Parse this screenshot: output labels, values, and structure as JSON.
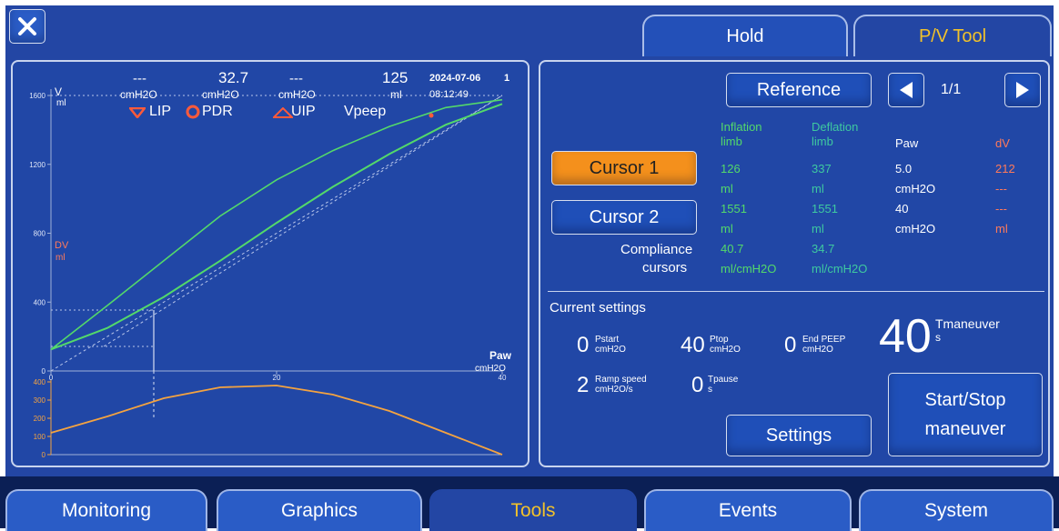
{
  "top_tabs": [
    {
      "label": "Hold"
    },
    {
      "label": "P/V Tool"
    }
  ],
  "graph": {
    "v_label": "V",
    "v_unit": "ml",
    "dv_label": "DV",
    "dv_unit": "ml",
    "paw_label": "Paw",
    "paw_unit": "cmH2O",
    "y_ticks": [
      "1600",
      "1200",
      "800",
      "400",
      "0"
    ],
    "x_ticks": [
      "0",
      "20",
      "40"
    ],
    "dv_ticks": [
      "400",
      "300",
      "200",
      "100",
      "0"
    ],
    "readouts": [
      {
        "value": "---",
        "unit": "cmH2O"
      },
      {
        "value": "32.7",
        "unit": "cmH2O"
      },
      {
        "value": "---",
        "unit": "cmH2O"
      },
      {
        "value": "125",
        "unit": "ml"
      }
    ],
    "date": "2024-07-06",
    "time": "08:12:49",
    "index": "1",
    "markers": {
      "lip": "LIP",
      "pdr": "PDR",
      "uip": "UIP",
      "vpeep": "Vpeep"
    },
    "colors": {
      "green": "#53d96a",
      "orange": "#f4a340",
      "marker": "#ff5a3a"
    }
  },
  "chart_data": [
    {
      "type": "line",
      "x": [
        0,
        5,
        10,
        15,
        20,
        25,
        30,
        35,
        40
      ],
      "series": [
        {
          "values": [
            125,
            380,
            640,
            900,
            1110,
            1280,
            1420,
            1530,
            1575
          ]
        },
        {
          "values": [
            125,
            250,
            430,
            640,
            860,
            1070,
            1260,
            1430,
            1551
          ]
        }
      ],
      "xlim": [
        0,
        40
      ],
      "ylim": [
        0,
        1600
      ]
    },
    {
      "type": "line",
      "x": [
        0,
        5,
        10,
        15,
        20,
        25,
        30,
        35,
        40
      ],
      "series": [
        {
          "values": [
            120,
            210,
            310,
            370,
            380,
            330,
            240,
            120,
            0
          ]
        }
      ],
      "xlim": [
        0,
        40
      ],
      "ylim": [
        0,
        400
      ]
    }
  ],
  "reference": {
    "button": "Reference",
    "page": "1/1"
  },
  "cursors": {
    "cursor1": "Cursor 1",
    "cursor2": "Cursor 2",
    "compliance": [
      "Compliance",
      "cursors"
    ]
  },
  "table": {
    "headers": [
      [
        "Inflation",
        "limb"
      ],
      [
        "Deflation",
        "limb"
      ],
      [
        "Paw"
      ],
      [
        "dV"
      ]
    ],
    "rows": [
      [
        "126",
        "337",
        "5.0",
        "212"
      ],
      [
        "ml",
        "ml",
        "cmH2O",
        "---"
      ],
      [
        "1551",
        "1551",
        "40",
        "---"
      ],
      [
        "ml",
        "ml",
        "cmH2O",
        "ml"
      ]
    ],
    "compliance": [
      [
        "40.7",
        "34.7"
      ],
      [
        "ml/cmH2O",
        "ml/cmH2O"
      ]
    ]
  },
  "settings": {
    "title": "Current settings",
    "pstart": {
      "value": "0",
      "label": "Pstart",
      "unit": "cmH2O"
    },
    "ptop": {
      "value": "40",
      "label": "Ptop",
      "unit": "cmH2O"
    },
    "endpeep": {
      "value": "0",
      "label": "End PEEP",
      "unit": "cmH2O"
    },
    "tman": {
      "value": "40",
      "label": "Tmaneuver",
      "unit": "s"
    },
    "ramp": {
      "value": "2",
      "label": "Ramp speed",
      "unit": "cmH2O/s"
    },
    "tpause": {
      "value": "0",
      "label": "Tpause",
      "unit": "s"
    },
    "settings_button": "Settings",
    "startstop": [
      "Start/Stop",
      "maneuver"
    ]
  },
  "bottom_tabs": [
    {
      "label": "Monitoring"
    },
    {
      "label": "Graphics"
    },
    {
      "label": "Tools"
    },
    {
      "label": "Events"
    },
    {
      "label": "System"
    }
  ]
}
